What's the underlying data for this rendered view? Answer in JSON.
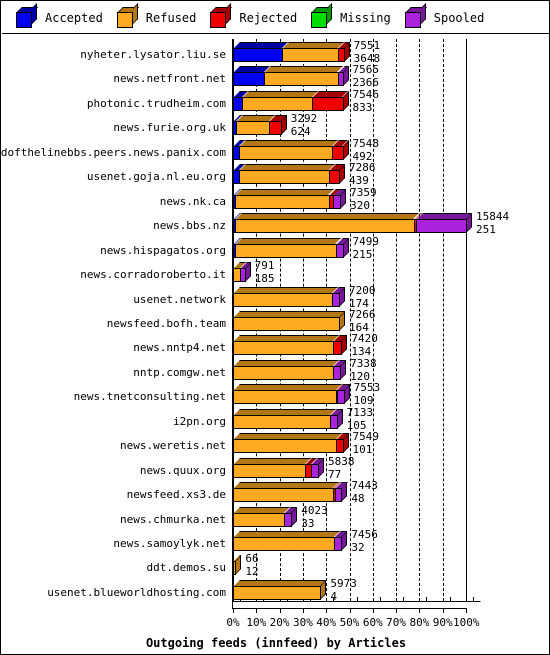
{
  "legend": {
    "items": [
      {
        "label": "Accepted",
        "color": "#0000ee",
        "icon": "cube-icon"
      },
      {
        "label": "Refused",
        "color": "#ffaa22",
        "icon": "cube-icon"
      },
      {
        "label": "Rejected",
        "color": "#ee0000",
        "icon": "cube-icon"
      },
      {
        "label": "Missing",
        "color": "#00dd00",
        "icon": "cube-icon"
      },
      {
        "label": "Spooled",
        "color": "#aa22dd",
        "icon": "cube-icon"
      }
    ]
  },
  "chart_data": {
    "type": "bar",
    "title": "Outgoing feeds (innfeed) by Articles",
    "xlabel": "Outgoing feeds (innfeed) by Articles",
    "ylabel": "",
    "orientation": "horizontal",
    "stacked": true,
    "xlim": [
      0,
      100
    ],
    "xunit": "%",
    "grid": true,
    "legend_position": "top",
    "xticks": [
      "0%",
      "10%",
      "20%",
      "30%",
      "40%",
      "50%",
      "60%",
      "70%",
      "80%",
      "90%",
      "100%"
    ],
    "series_names": [
      "Accepted",
      "Refused",
      "Rejected",
      "Missing",
      "Spooled"
    ],
    "series_colors": [
      "#0000ee",
      "#ffaa22",
      "#ee0000",
      "#00dd00",
      "#aa22dd"
    ],
    "categories": [
      "nyheter.lysator.liu.se",
      "news.netfront.net",
      "photonic.trudheim.com",
      "news.furie.org.uk",
      "endofthelinebbs.peers.news.panix.com",
      "usenet.goja.nl.eu.org",
      "news.nk.ca",
      "news.bbs.nz",
      "news.hispagatos.org",
      "news.corradoroberto.it",
      "usenet.network",
      "newsfeed.bofh.team",
      "news.nntp4.net",
      "nntp.comgw.net",
      "news.tnetconsulting.net",
      "i2pn.org",
      "news.weretis.net",
      "news.quux.org",
      "newsfeed.xs3.de",
      "news.chmurka.net",
      "news.samoylyk.net",
      "ddt.demos.su",
      "usenet.blueworldhosting.com"
    ],
    "labels_top": [
      7551,
      7565,
      7546,
      3292,
      7548,
      7286,
      7359,
      15844,
      7499,
      791,
      7200,
      7266,
      7420,
      7338,
      7553,
      7133,
      7549,
      5838,
      7443,
      4023,
      7456,
      66,
      5973
    ],
    "labels_bottom": [
      3648,
      2366,
      833,
      624,
      492,
      439,
      320,
      251,
      215,
      185,
      174,
      164,
      134,
      120,
      109,
      105,
      101,
      77,
      48,
      33,
      32,
      12,
      4
    ],
    "rows": [
      {
        "category": "nyheter.lysator.liu.se",
        "total_pct": 47.5,
        "label_top": "7551",
        "label_bottom": "3648",
        "segments": [
          {
            "name": "Accepted",
            "pct": 21.0
          },
          {
            "name": "Refused",
            "pct": 24.0
          },
          {
            "name": "Rejected",
            "pct": 2.5
          }
        ]
      },
      {
        "category": "news.netfront.net",
        "total_pct": 47.0,
        "label_top": "7565",
        "label_bottom": "2366",
        "segments": [
          {
            "name": "Accepted",
            "pct": 13.5
          },
          {
            "name": "Refused",
            "pct": 31.5
          },
          {
            "name": "Spooled",
            "pct": 2.0
          }
        ]
      },
      {
        "category": "photonic.trudheim.com",
        "total_pct": 47.0,
        "label_top": "7546",
        "label_bottom": "833",
        "segments": [
          {
            "name": "Accepted",
            "pct": 4.0
          },
          {
            "name": "Refused",
            "pct": 30.0
          },
          {
            "name": "Rejected",
            "pct": 13.0
          }
        ]
      },
      {
        "category": "news.furie.org.uk",
        "total_pct": 20.5,
        "label_top": "3292",
        "label_bottom": "624",
        "segments": [
          {
            "name": "Accepted",
            "pct": 1.5
          },
          {
            "name": "Refused",
            "pct": 14.0
          },
          {
            "name": "Rejected",
            "pct": 5.0
          }
        ]
      },
      {
        "category": "endofthelinebbs.peers.news.panix.com",
        "total_pct": 47.0,
        "label_top": "7548",
        "label_bottom": "492",
        "segments": [
          {
            "name": "Accepted",
            "pct": 2.5
          },
          {
            "name": "Refused",
            "pct": 40.0
          },
          {
            "name": "Rejected",
            "pct": 4.5
          }
        ]
      },
      {
        "category": "usenet.goja.nl.eu.org",
        "total_pct": 45.5,
        "label_top": "7286",
        "label_bottom": "439",
        "segments": [
          {
            "name": "Accepted",
            "pct": 2.5
          },
          {
            "name": "Refused",
            "pct": 38.5
          },
          {
            "name": "Rejected",
            "pct": 4.5
          }
        ]
      },
      {
        "category": "news.nk.ca",
        "total_pct": 46.0,
        "label_top": "7359",
        "label_bottom": "320",
        "segments": [
          {
            "name": "Accepted",
            "pct": 1.0
          },
          {
            "name": "Refused",
            "pct": 40.0
          },
          {
            "name": "Rejected",
            "pct": 2.0
          },
          {
            "name": "Spooled",
            "pct": 3.0
          }
        ]
      },
      {
        "category": "news.bbs.nz",
        "total_pct": 100.0,
        "label_top": "15844",
        "label_bottom": "251",
        "segments": [
          {
            "name": "Accepted",
            "pct": 1.0
          },
          {
            "name": "Refused",
            "pct": 76.5
          },
          {
            "name": "Rejected",
            "pct": 1.0
          },
          {
            "name": "Spooled",
            "pct": 21.5
          }
        ]
      },
      {
        "category": "news.hispagatos.org",
        "total_pct": 47.0,
        "label_top": "7499",
        "label_bottom": "215",
        "segments": [
          {
            "name": "Accepted",
            "pct": 1.0
          },
          {
            "name": "Refused",
            "pct": 43.0
          },
          {
            "name": "Spooled",
            "pct": 3.0
          }
        ]
      },
      {
        "category": "news.corradoroberto.it",
        "total_pct": 5.0,
        "label_top": "791",
        "label_bottom": "185",
        "segments": [
          {
            "name": "Refused",
            "pct": 3.0
          },
          {
            "name": "Spooled",
            "pct": 2.0
          }
        ]
      },
      {
        "category": "usenet.network",
        "total_pct": 45.5,
        "label_top": "7200",
        "label_bottom": "174",
        "segments": [
          {
            "name": "Refused",
            "pct": 42.5
          },
          {
            "name": "Spooled",
            "pct": 3.0
          }
        ]
      },
      {
        "category": "newsfeed.bofh.team",
        "total_pct": 45.5,
        "label_top": "7266",
        "label_bottom": "164",
        "segments": [
          {
            "name": "Refused",
            "pct": 45.5
          }
        ]
      },
      {
        "category": "news.nntp4.net",
        "total_pct": 46.5,
        "label_top": "7420",
        "label_bottom": "134",
        "segments": [
          {
            "name": "Refused",
            "pct": 43.0
          },
          {
            "name": "Rejected",
            "pct": 3.5
          }
        ]
      },
      {
        "category": "nntp.comgw.net",
        "total_pct": 46.0,
        "label_top": "7338",
        "label_bottom": "120",
        "segments": [
          {
            "name": "Refused",
            "pct": 43.0
          },
          {
            "name": "Spooled",
            "pct": 3.0
          }
        ]
      },
      {
        "category": "news.tnetconsulting.net",
        "total_pct": 47.5,
        "label_top": "7553",
        "label_bottom": "109",
        "segments": [
          {
            "name": "Refused",
            "pct": 44.0
          },
          {
            "name": "Rejected",
            "pct": 0.7
          },
          {
            "name": "Spooled",
            "pct": 2.8
          }
        ]
      },
      {
        "category": "i2pn.org",
        "total_pct": 44.5,
        "label_top": "7133",
        "label_bottom": "105",
        "segments": [
          {
            "name": "Refused",
            "pct": 41.5
          },
          {
            "name": "Spooled",
            "pct": 3.0
          }
        ]
      },
      {
        "category": "news.weretis.net",
        "total_pct": 47.0,
        "label_top": "7549",
        "label_bottom": "101",
        "segments": [
          {
            "name": "Refused",
            "pct": 44.0
          },
          {
            "name": "Rejected",
            "pct": 3.0
          }
        ]
      },
      {
        "category": "news.quux.org",
        "total_pct": 36.5,
        "label_top": "5838",
        "label_bottom": "77",
        "segments": [
          {
            "name": "Refused",
            "pct": 31.0
          },
          {
            "name": "Rejected",
            "pct": 2.5
          },
          {
            "name": "Spooled",
            "pct": 3.0
          }
        ]
      },
      {
        "category": "newsfeed.xs3.de",
        "total_pct": 46.5,
        "label_top": "7443",
        "label_bottom": "48",
        "segments": [
          {
            "name": "Refused",
            "pct": 43.0
          },
          {
            "name": "Rejected",
            "pct": 0.7
          },
          {
            "name": "Spooled",
            "pct": 2.8
          }
        ]
      },
      {
        "category": "news.chmurka.net",
        "total_pct": 25.0,
        "label_top": "4023",
        "label_bottom": "33",
        "segments": [
          {
            "name": "Refused",
            "pct": 22.0
          },
          {
            "name": "Spooled",
            "pct": 3.0
          }
        ]
      },
      {
        "category": "news.samoylyk.net",
        "total_pct": 46.5,
        "label_top": "7456",
        "label_bottom": "32",
        "segments": [
          {
            "name": "Refused",
            "pct": 43.5
          },
          {
            "name": "Spooled",
            "pct": 3.0
          }
        ]
      },
      {
        "category": "ddt.demos.su",
        "total_pct": 1.0,
        "label_top": "66",
        "label_bottom": "12",
        "segments": [
          {
            "name": "Refused",
            "pct": 1.0
          }
        ]
      },
      {
        "category": "usenet.blueworldhosting.com",
        "total_pct": 37.5,
        "label_top": "5973",
        "label_bottom": "4",
        "segments": [
          {
            "name": "Refused",
            "pct": 37.5
          }
        ]
      }
    ]
  }
}
